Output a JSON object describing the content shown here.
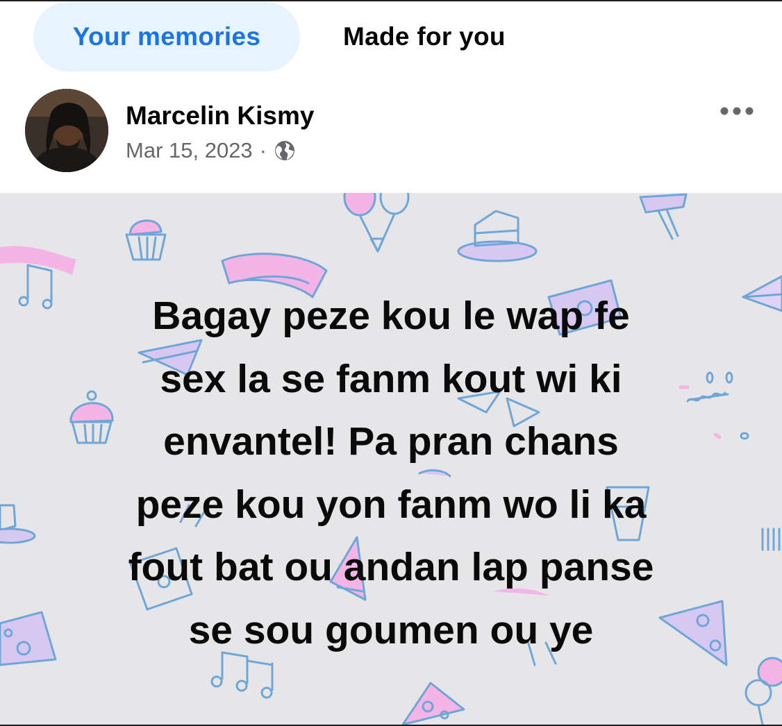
{
  "tabs": [
    {
      "label": "Your memories",
      "active": true
    },
    {
      "label": "Made for you",
      "active": false
    }
  ],
  "post": {
    "author": "Marcelin Kismy",
    "date": "Mar 15, 2023",
    "separator": "·",
    "audience_icon": "globe-icon",
    "menu_icon": "more-options-icon",
    "text_lines": [
      "Bagay peze kou le wap fe",
      "sex la se fanm kout wi ki",
      "envantel! Pa pran chans",
      "peze kou yon fanm wo li ka",
      "fout bat ou andan lap panse",
      "se sou goumen ou ye"
    ],
    "background_theme": "party-doodles",
    "colors": {
      "background": "#e6e6e8",
      "doodle_stroke": "#6fa6d8",
      "doodle_fill_pink": "#f4b5e6",
      "doodle_fill_lilac": "#d7c8f2"
    }
  },
  "colors": {
    "accent": "#1b74e4",
    "active_tab_bg": "#e7f3ff",
    "secondary_text": "#65676b"
  }
}
